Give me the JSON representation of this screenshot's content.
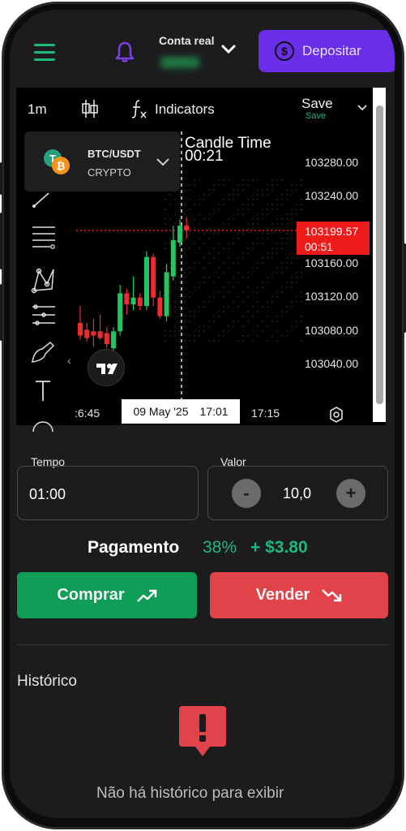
{
  "header": {
    "account_title": "Conta real",
    "deposit_label": "Depositar",
    "icons": [
      "menu-icon",
      "bell-icon",
      "chevron-down-icon",
      "dollar-icon"
    ]
  },
  "toolbar": {
    "timeframe": "1m",
    "indicators_label": "Indicators",
    "save_label": "Save",
    "save_sub_label": "Save"
  },
  "asset": {
    "pair": "BTC/USDT",
    "category": "CRYPTO"
  },
  "chart": {
    "candle_time_label": "Candle Time",
    "candle_time_value": "00:21",
    "price_ticks": [
      "103280.00",
      "103240.00",
      "103160.00",
      "103120.00",
      "103080.00",
      "103040.00"
    ],
    "current_price": "103199.57",
    "current_countdown": "00:51",
    "time_ticks": [
      ":6:45",
      "17:15"
    ],
    "crosshair_date": "09 May '25",
    "crosshair_time": "17:01",
    "colors": {
      "up": "#22c55e",
      "down": "#ef2b2b",
      "price_line": "#ee1b1b"
    }
  },
  "chart_data": {
    "type": "candlestick",
    "title": "",
    "ylim": [
      103020,
      103300
    ],
    "candles": [
      {
        "o": 103090,
        "h": 103110,
        "l": 103070,
        "c": 103075,
        "dir": "down"
      },
      {
        "o": 103082,
        "h": 103090,
        "l": 103068,
        "c": 103072,
        "dir": "down"
      },
      {
        "o": 103075,
        "h": 103095,
        "l": 103062,
        "c": 103080,
        "dir": "down"
      },
      {
        "o": 103080,
        "h": 103100,
        "l": 103070,
        "c": 103072,
        "dir": "down"
      },
      {
        "o": 103078,
        "h": 103085,
        "l": 103060,
        "c": 103065,
        "dir": "down"
      },
      {
        "o": 103060,
        "h": 103085,
        "l": 103050,
        "c": 103080,
        "dir": "up"
      },
      {
        "o": 103080,
        "h": 103135,
        "l": 103075,
        "c": 103125,
        "dir": "up"
      },
      {
        "o": 103125,
        "h": 103130,
        "l": 103100,
        "c": 103112,
        "dir": "down"
      },
      {
        "o": 103112,
        "h": 103145,
        "l": 103105,
        "c": 103120,
        "dir": "up"
      },
      {
        "o": 103120,
        "h": 103125,
        "l": 103105,
        "c": 103110,
        "dir": "down"
      },
      {
        "o": 103110,
        "h": 103175,
        "l": 103105,
        "c": 103168,
        "dir": "up"
      },
      {
        "o": 103168,
        "h": 103172,
        "l": 103110,
        "c": 103120,
        "dir": "down"
      },
      {
        "o": 103120,
        "h": 103128,
        "l": 103095,
        "c": 103098,
        "dir": "down"
      },
      {
        "o": 103098,
        "h": 103160,
        "l": 103092,
        "c": 103150,
        "dir": "up"
      },
      {
        "o": 103145,
        "h": 103205,
        "l": 103140,
        "c": 103188,
        "dir": "up"
      },
      {
        "o": 103185,
        "h": 103212,
        "l": 103180,
        "c": 103205,
        "dir": "up"
      },
      {
        "o": 103205,
        "h": 103215,
        "l": 103190,
        "c": 103199.57,
        "dir": "down"
      }
    ]
  },
  "controls": {
    "tempo_label": "Tempo",
    "tempo_value": "01:00",
    "valor_label": "Valor",
    "valor_value": "10,0",
    "minus": "-",
    "plus": "+"
  },
  "payout": {
    "label": "Pagamento",
    "percent": "38%",
    "amount": "+ $3.80"
  },
  "actions": {
    "buy_label": "Comprar",
    "sell_label": "Vender",
    "colors": {
      "buy": "#0f9d58",
      "sell": "#e0444a"
    }
  },
  "history": {
    "title": "Histórico",
    "empty_message": "Não há histórico para exibir"
  }
}
